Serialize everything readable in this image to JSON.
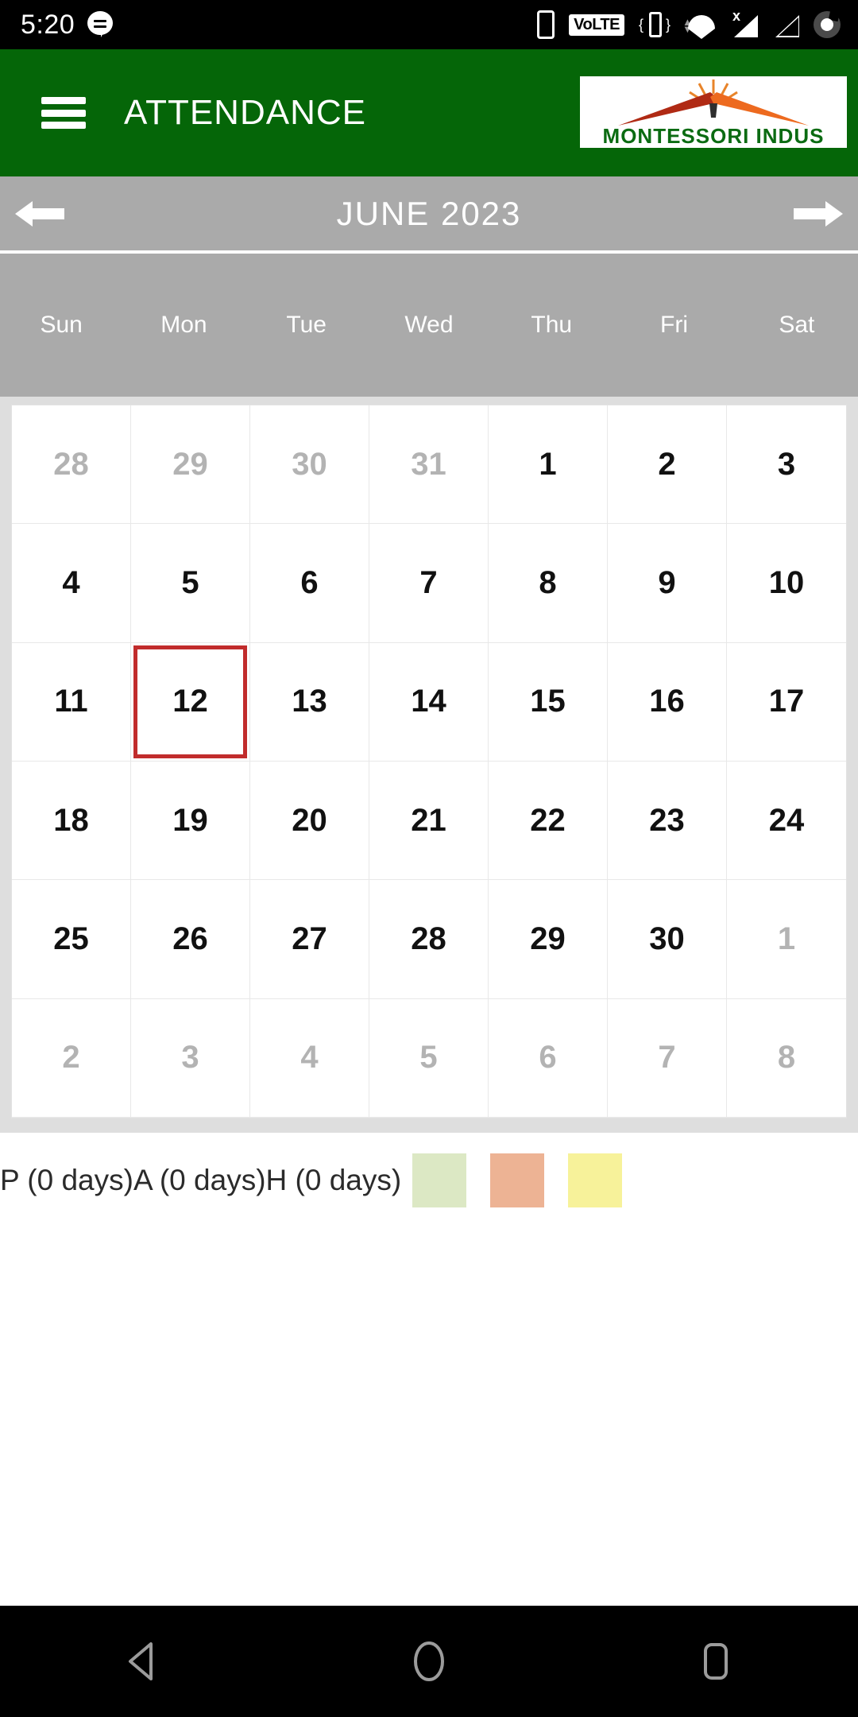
{
  "status_bar": {
    "time": "5:20",
    "left_icons": [
      "chat-bubble-icon"
    ],
    "right_icons": [
      "phone-icon",
      "volte-badge",
      "vibrate-icon",
      "wifi-icon",
      "signal-no-service-icon",
      "signal-icon",
      "battery-icon"
    ],
    "volte_label": "VoLTE"
  },
  "app_bar": {
    "menu_icon": "hamburger-menu-icon",
    "title": "ATTENDANCE",
    "logo_text": "MONTESSORI INDUS",
    "background_color": "#056608"
  },
  "month_nav": {
    "prev_label": "←",
    "next_label": "→",
    "title": "JUNE 2023",
    "background_color": "#aaaaaa"
  },
  "calendar": {
    "weekdays": [
      "Sun",
      "Mon",
      "Tue",
      "Wed",
      "Thu",
      "Fri",
      "Sat"
    ],
    "selected_day": 12,
    "selected_color": "#c12c2c",
    "weeks": [
      [
        {
          "d": "28",
          "muted": true
        },
        {
          "d": "29",
          "muted": true
        },
        {
          "d": "30",
          "muted": true
        },
        {
          "d": "31",
          "muted": true
        },
        {
          "d": "1",
          "muted": false
        },
        {
          "d": "2",
          "muted": false
        },
        {
          "d": "3",
          "muted": false
        }
      ],
      [
        {
          "d": "4",
          "muted": false
        },
        {
          "d": "5",
          "muted": false
        },
        {
          "d": "6",
          "muted": false
        },
        {
          "d": "7",
          "muted": false
        },
        {
          "d": "8",
          "muted": false
        },
        {
          "d": "9",
          "muted": false
        },
        {
          "d": "10",
          "muted": false
        }
      ],
      [
        {
          "d": "11",
          "muted": false
        },
        {
          "d": "12",
          "muted": false,
          "today": true
        },
        {
          "d": "13",
          "muted": false
        },
        {
          "d": "14",
          "muted": false
        },
        {
          "d": "15",
          "muted": false
        },
        {
          "d": "16",
          "muted": false
        },
        {
          "d": "17",
          "muted": false
        }
      ],
      [
        {
          "d": "18",
          "muted": false
        },
        {
          "d": "19",
          "muted": false
        },
        {
          "d": "20",
          "muted": false
        },
        {
          "d": "21",
          "muted": false
        },
        {
          "d": "22",
          "muted": false
        },
        {
          "d": "23",
          "muted": false
        },
        {
          "d": "24",
          "muted": false
        }
      ],
      [
        {
          "d": "25",
          "muted": false
        },
        {
          "d": "26",
          "muted": false
        },
        {
          "d": "27",
          "muted": false
        },
        {
          "d": "28",
          "muted": false
        },
        {
          "d": "29",
          "muted": false
        },
        {
          "d": "30",
          "muted": false
        },
        {
          "d": "1",
          "muted": true
        }
      ],
      [
        {
          "d": "2",
          "muted": true
        },
        {
          "d": "3",
          "muted": true
        },
        {
          "d": "4",
          "muted": true
        },
        {
          "d": "5",
          "muted": true
        },
        {
          "d": "6",
          "muted": true
        },
        {
          "d": "7",
          "muted": true
        },
        {
          "d": "8",
          "muted": true
        }
      ]
    ]
  },
  "legend": {
    "summary_text": "P (0 days)A (0 days)H (0 days)",
    "present_label": "P (0 days)",
    "absent_label": "A (0 days)",
    "holiday_label": "H (0 days)",
    "swatches": [
      {
        "name": "present-swatch",
        "color": "#dce8c4"
      },
      {
        "name": "absent-swatch",
        "color": "#edb394"
      },
      {
        "name": "holiday-swatch",
        "color": "#f7f29a"
      }
    ]
  },
  "nav_bar": {
    "back_label": "back-icon",
    "home_label": "home-icon",
    "recents_label": "recents-icon"
  }
}
